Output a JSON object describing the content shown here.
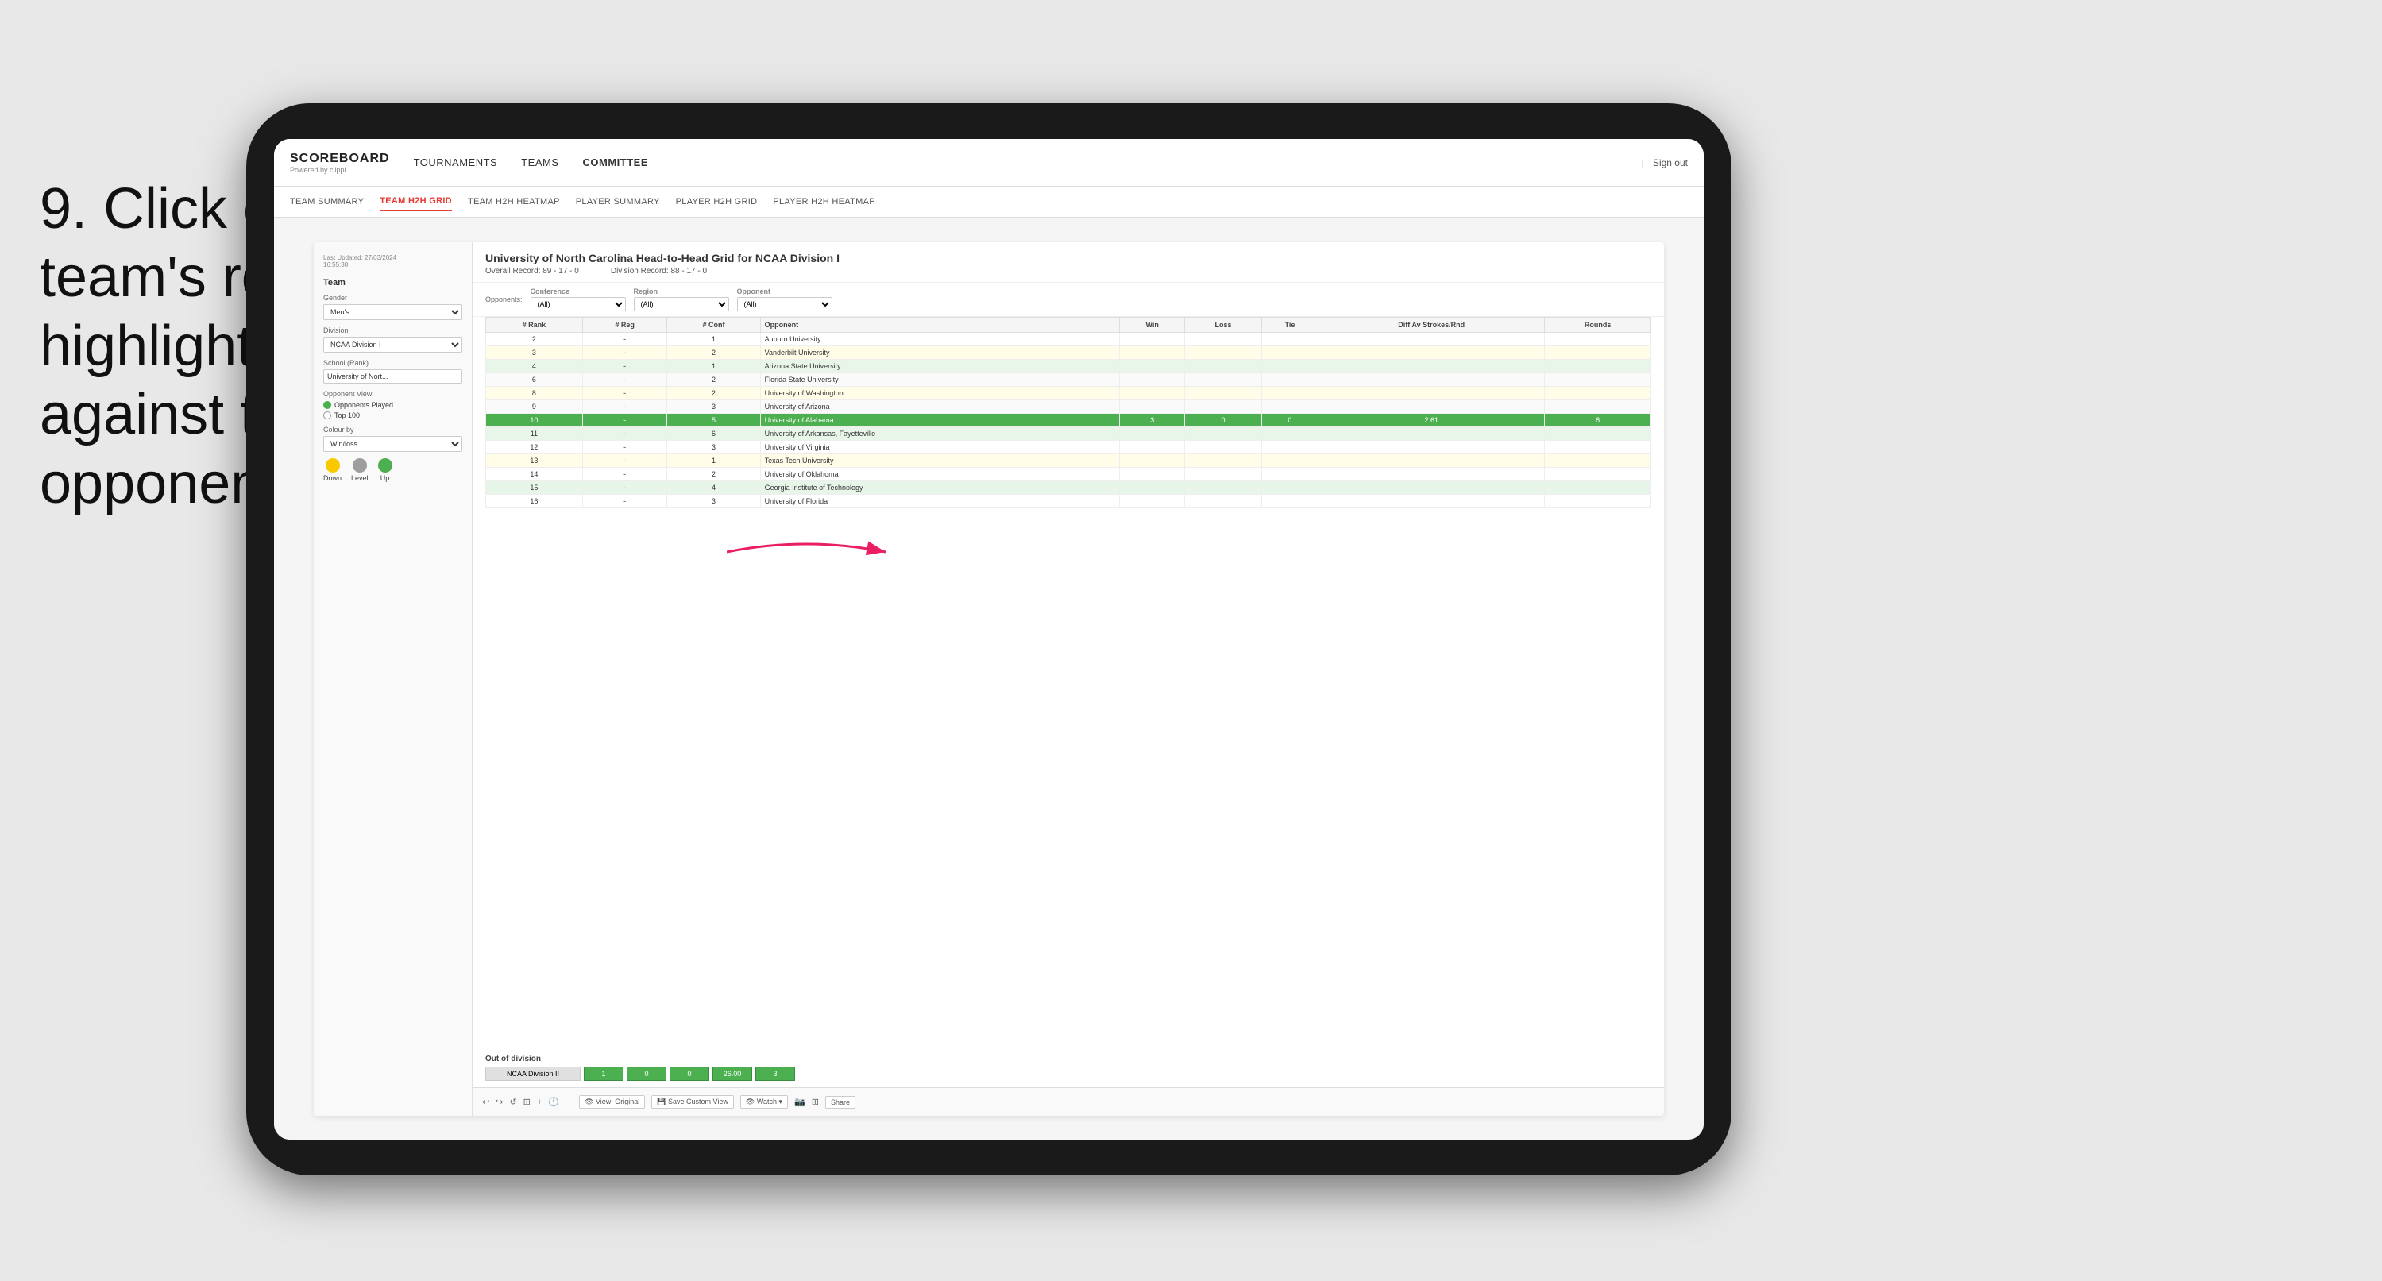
{
  "instruction": {
    "number": "9.",
    "text": "Click on a team's row to highlight results against that opponent"
  },
  "nav": {
    "logo": "SCOREBOARD",
    "logo_sub": "Powered by clippi",
    "items": [
      "TOURNAMENTS",
      "TEAMS",
      "COMMITTEE"
    ],
    "sign_out": "Sign out"
  },
  "sub_nav": {
    "items": [
      "TEAM SUMMARY",
      "TEAM H2H GRID",
      "TEAM H2H HEATMAP",
      "PLAYER SUMMARY",
      "PLAYER H2H GRID",
      "PLAYER H2H HEATMAP"
    ],
    "active": "TEAM H2H GRID"
  },
  "sidebar": {
    "timestamp_label": "Last Updated: 27/03/2024",
    "timestamp_time": "16:55:38",
    "team_label": "Team",
    "gender_label": "Gender",
    "gender_value": "Men's",
    "division_label": "Division",
    "division_value": "NCAA Division I",
    "school_label": "School (Rank)",
    "school_value": "University of Nort...",
    "opponent_view_label": "Opponent View",
    "radio_options": [
      "Opponents Played",
      "Top 100"
    ],
    "radio_checked": 0,
    "colour_by_label": "Colour by",
    "colour_by_value": "Win/loss",
    "colours": [
      {
        "name": "Down",
        "color": "#f9c900"
      },
      {
        "name": "Level",
        "color": "#9e9e9e"
      },
      {
        "name": "Up",
        "color": "#4CAF50"
      }
    ]
  },
  "grid": {
    "title": "University of North Carolina Head-to-Head Grid for NCAA Division I",
    "overall_record_label": "Overall Record:",
    "overall_record": "89 - 17 - 0",
    "division_record_label": "Division Record:",
    "division_record": "88 - 17 - 0",
    "filters": {
      "opponents_label": "Opponents:",
      "conference_label": "Conference",
      "conference_value": "(All)",
      "region_label": "Region",
      "region_value": "(All)",
      "opponent_label": "Opponent",
      "opponent_value": "(All)"
    },
    "columns": [
      "# Rank",
      "# Reg",
      "# Conf",
      "Opponent",
      "Win",
      "Loss",
      "Tie",
      "Diff Av Strokes/Rnd",
      "Rounds"
    ],
    "rows": [
      {
        "rank": "2",
        "reg": "-",
        "conf": "1",
        "opponent": "Auburn University",
        "win": "",
        "loss": "",
        "tie": "",
        "diff": "",
        "rounds": "",
        "style": "normal"
      },
      {
        "rank": "3",
        "reg": "-",
        "conf": "2",
        "opponent": "Vanderbilt University",
        "win": "",
        "loss": "",
        "tie": "",
        "diff": "",
        "rounds": "",
        "style": "light-yellow"
      },
      {
        "rank": "4",
        "reg": "-",
        "conf": "1",
        "opponent": "Arizona State University",
        "win": "",
        "loss": "",
        "tie": "",
        "diff": "",
        "rounds": "",
        "style": "light-green"
      },
      {
        "rank": "6",
        "reg": "-",
        "conf": "2",
        "opponent": "Florida State University",
        "win": "",
        "loss": "",
        "tie": "",
        "diff": "",
        "rounds": "",
        "style": "normal"
      },
      {
        "rank": "8",
        "reg": "-",
        "conf": "2",
        "opponent": "University of Washington",
        "win": "",
        "loss": "",
        "tie": "",
        "diff": "",
        "rounds": "",
        "style": "light-yellow"
      },
      {
        "rank": "9",
        "reg": "-",
        "conf": "3",
        "opponent": "University of Arizona",
        "win": "",
        "loss": "",
        "tie": "",
        "diff": "",
        "rounds": "",
        "style": "normal"
      },
      {
        "rank": "10",
        "reg": "-",
        "conf": "5",
        "opponent": "University of Alabama",
        "win": "3",
        "loss": "0",
        "tie": "0",
        "diff": "2.61",
        "rounds": "8",
        "style": "highlighted"
      },
      {
        "rank": "11",
        "reg": "-",
        "conf": "6",
        "opponent": "University of Arkansas, Fayetteville",
        "win": "",
        "loss": "",
        "tie": "",
        "diff": "",
        "rounds": "",
        "style": "light-green"
      },
      {
        "rank": "12",
        "reg": "-",
        "conf": "3",
        "opponent": "University of Virginia",
        "win": "",
        "loss": "",
        "tie": "",
        "diff": "",
        "rounds": "",
        "style": "normal"
      },
      {
        "rank": "13",
        "reg": "-",
        "conf": "1",
        "opponent": "Texas Tech University",
        "win": "",
        "loss": "",
        "tie": "",
        "diff": "",
        "rounds": "",
        "style": "light-yellow"
      },
      {
        "rank": "14",
        "reg": "-",
        "conf": "2",
        "opponent": "University of Oklahoma",
        "win": "",
        "loss": "",
        "tie": "",
        "diff": "",
        "rounds": "",
        "style": "normal"
      },
      {
        "rank": "15",
        "reg": "-",
        "conf": "4",
        "opponent": "Georgia Institute of Technology",
        "win": "",
        "loss": "",
        "tie": "",
        "diff": "",
        "rounds": "",
        "style": "light-green"
      },
      {
        "rank": "16",
        "reg": "-",
        "conf": "3",
        "opponent": "University of Florida",
        "win": "",
        "loss": "",
        "tie": "",
        "diff": "",
        "rounds": "",
        "style": "normal"
      }
    ],
    "out_of_division": {
      "title": "Out of division",
      "label": "NCAA Division II",
      "win": "1",
      "loss": "0",
      "tie": "0",
      "diff": "26.00",
      "rounds": "3"
    }
  },
  "toolbar": {
    "buttons": [
      "View: Original",
      "Save Custom View",
      "Watch ▾",
      "Share"
    ]
  }
}
